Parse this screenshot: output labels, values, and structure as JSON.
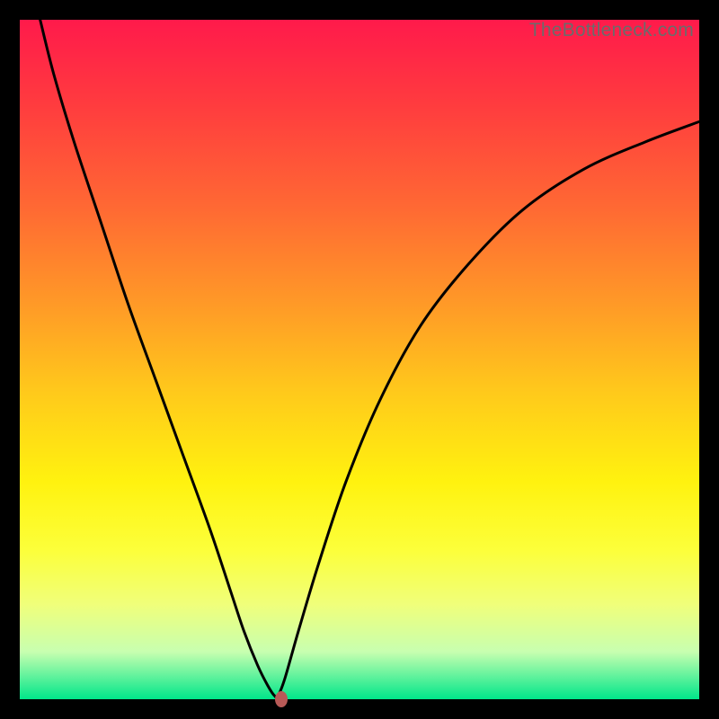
{
  "watermark": "TheBottleneck.com",
  "chart_data": {
    "type": "line",
    "title": "",
    "xlabel": "",
    "ylabel": "",
    "xlim": [
      0,
      100
    ],
    "ylim": [
      0,
      100
    ],
    "grid": false,
    "legend": false,
    "series": [
      {
        "name": "curve",
        "x": [
          3,
          5,
          8,
          12,
          16,
          20,
          24,
          28,
          31,
          33,
          35,
          36.5,
          37.5,
          38,
          39,
          41,
          44,
          48,
          53,
          59,
          66,
          74,
          83,
          92,
          100
        ],
        "y": [
          100,
          92,
          82,
          70,
          58,
          47,
          36,
          25,
          16,
          10,
          5,
          2,
          0.5,
          0.5,
          3,
          10,
          20,
          32,
          44,
          55,
          64,
          72,
          78,
          82,
          85
        ]
      }
    ],
    "marker": {
      "label": "min-point",
      "x": 38.5,
      "y": 0
    },
    "background_gradient": {
      "top": "#ff1a4b",
      "mid": "#fff20f",
      "bottom": "#00e68a"
    }
  }
}
